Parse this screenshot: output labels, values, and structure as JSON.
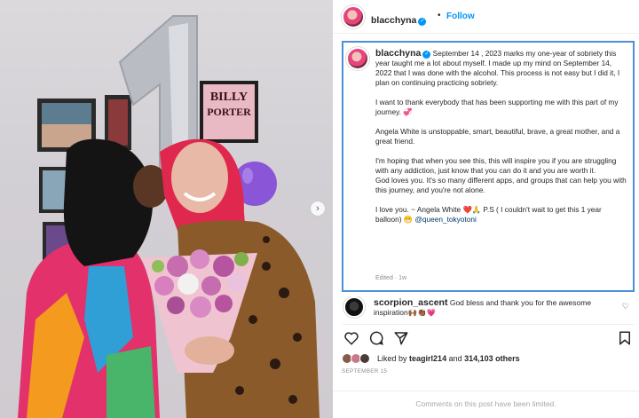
{
  "post": {
    "username": "blacchyna",
    "follow_label": "Follow",
    "dot": "•",
    "photo_frame_text_1": "BILLY",
    "photo_frame_text_2": "PORTER",
    "caption_lead": "September 14 , 2023 marks my one-year of sobriety this year taught me a lot about myself. I made up my mind on September 14, 2022 that I was done with the alcohol. This process is not easy but I did it, I plan on continuing practicing sobriety.",
    "caption_p2": "I want to thank everybody that has been supporting me with this part of my journey. 💞",
    "caption_p3": "Angela White is unstoppable, smart, beautiful, brave, a great mother, and a great friend.",
    "caption_p4": "I'm hoping that when you see this, this will inspire you if you are struggling with any addiction, just know that you can do it and you are worth it.",
    "caption_p5": "God loves you. It's so many different apps, and groups that can help you with this journey, and you're not alone.",
    "caption_p6": "I love you. ~ Angela White ❤️🙏 P.S ( I couldn't wait to get this 1 year balloon) 😁",
    "caption_mention": "@queen_tokyotoni",
    "edited_label": "Edited · 1w"
  },
  "comment": {
    "username": "scorpion_ascent",
    "text": "God bless and thank you for the awesome inspiration🙌🏾👏🏾💗"
  },
  "likes": {
    "prefix": "Liked by",
    "user": "teagirl214",
    "and": "and",
    "others": "314,103 others"
  },
  "date": "SEPTEMBER 15",
  "comments_limited": "Comments on this post have been limited.",
  "icons": [
    "heart-icon",
    "comment-icon",
    "share-icon",
    "bookmark-icon",
    "verified-icon",
    "carousel-next-icon"
  ],
  "colors": {
    "follow": "#0095f6",
    "verified": "#0095f6",
    "highlight_border": "#4a90d9"
  }
}
